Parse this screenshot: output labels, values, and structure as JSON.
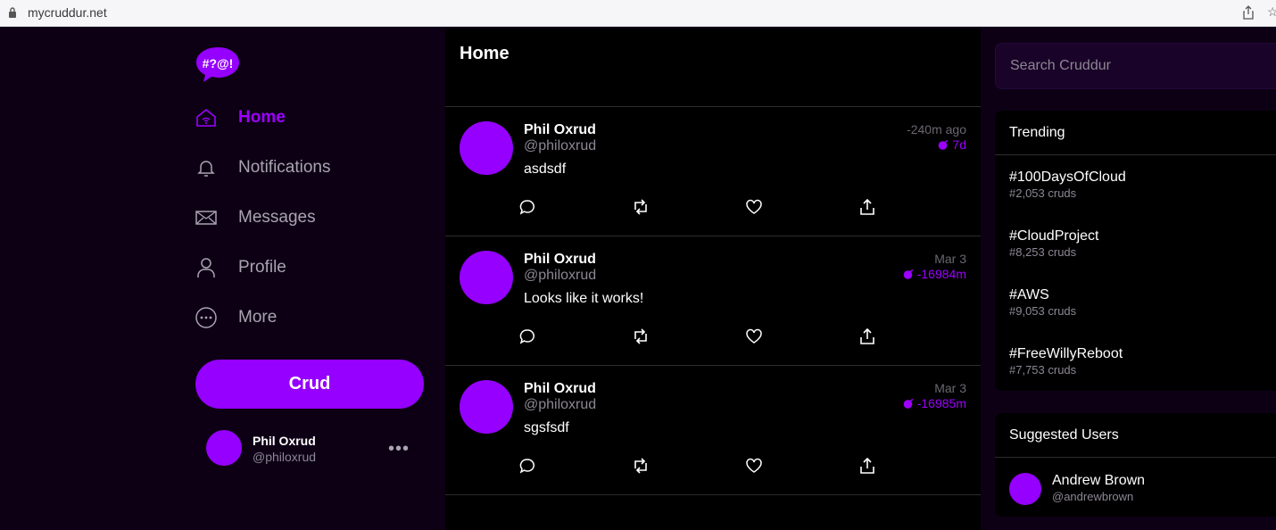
{
  "browser": {
    "url": "mycruddur.net"
  },
  "brand": {
    "logo_text": "#?@!",
    "accent": "#9500ff"
  },
  "nav": {
    "items": [
      {
        "label": "Home",
        "icon": "home-icon"
      },
      {
        "label": "Notifications",
        "icon": "bell-icon"
      },
      {
        "label": "Messages",
        "icon": "envelope-icon"
      },
      {
        "label": "Profile",
        "icon": "person-icon"
      },
      {
        "label": "More",
        "icon": "more-circle-icon"
      }
    ],
    "crud_label": "Crud"
  },
  "current_user": {
    "name": "Phil Oxrud",
    "handle": "@philoxrud",
    "menu": "•••"
  },
  "feed": {
    "title": "Home",
    "posts": [
      {
        "name": "Phil Oxrud",
        "handle": "@philoxrud",
        "message": "asdsdf",
        "time": "-240m ago",
        "expires": "7d"
      },
      {
        "name": "Phil Oxrud",
        "handle": "@philoxrud",
        "message": "Looks like it works!",
        "time": "Mar 3",
        "expires": "-16984m"
      },
      {
        "name": "Phil Oxrud",
        "handle": "@philoxrud",
        "message": "sgsfsdf",
        "time": "Mar 3",
        "expires": "-16985m"
      }
    ]
  },
  "search": {
    "placeholder": "Search Cruddur"
  },
  "trending": {
    "title": "Trending",
    "items": [
      {
        "tag": "#100DaysOfCloud",
        "count": "#2,053 cruds"
      },
      {
        "tag": "#CloudProject",
        "count": "#8,253 cruds"
      },
      {
        "tag": "#AWS",
        "count": "#9,053 cruds"
      },
      {
        "tag": "#FreeWillyReboot",
        "count": "#7,753 cruds"
      }
    ]
  },
  "suggested": {
    "title": "Suggested Users",
    "users": [
      {
        "name": "Andrew Brown",
        "handle": "@andrewbrown"
      }
    ]
  }
}
